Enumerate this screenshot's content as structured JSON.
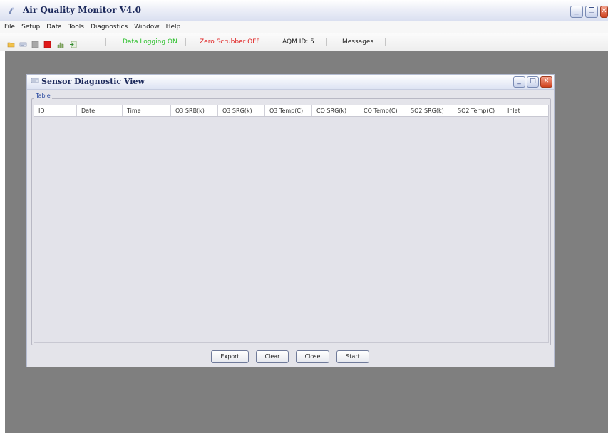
{
  "window": {
    "title": "Air Quality Monitor V4.0",
    "controls": [
      "_",
      "❐",
      "✕"
    ]
  },
  "menu": [
    "File",
    "Setup",
    "Data",
    "Tools",
    "Diagnostics",
    "Window",
    "Help"
  ],
  "toolbar": {
    "icons": [
      "open-folder-icon",
      "sensor-icon",
      "stop-gray-icon",
      "record-red-icon",
      "chart-icon",
      "export-green-icon"
    ],
    "status": [
      {
        "text": "Data Logging ON",
        "color": "#2cc02c"
      },
      {
        "text": "Zero Scrubber OFF",
        "color": "#e02020"
      },
      {
        "text": "AQM ID: 5",
        "color": "#222222"
      },
      {
        "text": "Messages",
        "color": "#222222"
      }
    ]
  },
  "dialog": {
    "title": "Sensor Diagnostic View",
    "controls": [
      "_",
      "□",
      "✕"
    ],
    "table_legend": "Table",
    "columns": [
      "ID",
      "Date",
      "Time",
      "O3 SRB(k)",
      "O3 SRG(k)",
      "O3 Temp(C)",
      "CO SRG(k)",
      "CO Temp(C)",
      "SO2 SRG(k)",
      "SO2 Temp(C)",
      "Inlet"
    ],
    "buttons": {
      "export": "Export",
      "clear": "Clear",
      "close": "Close",
      "start": "Start"
    }
  },
  "colors": {
    "workspace": "#7f7f7f",
    "title_text": "#1d2a5c",
    "accent_link": "#2a4aa0"
  }
}
